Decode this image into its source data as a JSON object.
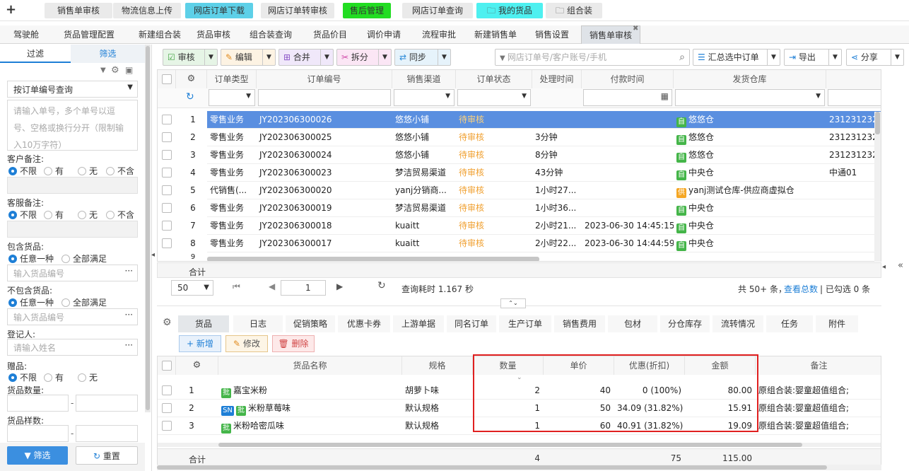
{
  "top_tabs": [
    {
      "label": "销售单审核",
      "bg": "#eaeaea"
    },
    {
      "label": "物流信息上传",
      "bg": "#eaeaea"
    },
    {
      "label": "网店订单下载",
      "bg": "#5dd0e8"
    },
    {
      "label": "网店订单转审核",
      "bg": "#eaeaea"
    },
    {
      "label": "售后管理",
      "bg": "#22dd22"
    },
    {
      "label": "网店订单查询",
      "bg": "#eaeaea"
    },
    {
      "label": "我的货品",
      "bg": "#4ef0f0"
    },
    {
      "label": "组合装",
      "bg": "#eaeaea"
    }
  ],
  "sub_tabs": [
    "驾驶舱",
    "货品管理配置",
    "新建组合装",
    "货品审核",
    "组合装查询",
    "货品价目",
    "调价申请",
    "流程审批",
    "新建销售单",
    "销售设置",
    "销售单审核"
  ],
  "left": {
    "tab_filter": "过滤",
    "tab_screen": "筛选",
    "query_select": "按订单编号查询",
    "order_placeholder": "请输入单号，多个单号以逗号、空格或换行分开（限制输入10万字符）",
    "customer_note": "客户备注:",
    "service_note": "客服备注:",
    "opts4": [
      "不限",
      "有",
      "无",
      "不含"
    ],
    "contains_goods": "包含货品:",
    "not_contains_goods": "不包含货品:",
    "opts2": [
      "任意一种",
      "全部满足"
    ],
    "goods_code_placeholder": "输入货品编号",
    "registrant": "登记人:",
    "name_placeholder": "请输入姓名",
    "gift": "赠品:",
    "opts3": [
      "不限",
      "有",
      "无"
    ],
    "goods_qty": "货品数量:",
    "goods_kinds": "货品样数:",
    "filter_btn": "筛选",
    "reset_btn": "重置"
  },
  "toolbar": {
    "audit": "审核",
    "edit": "编辑",
    "merge": "合并",
    "split": "拆分",
    "sync": "同步",
    "search_placeholder": "网店订单号/客户账号/手机",
    "summary": "汇总选中订单",
    "export": "导出",
    "share": "分享"
  },
  "grid": {
    "headers": [
      "订单类型",
      "订单编号",
      "销售渠道",
      "订单状态",
      "处理时间",
      "付款时间",
      "发货仓库"
    ],
    "rows": [
      {
        "n": "1",
        "type": "零售业务",
        "no": "JY202306300026",
        "ch": "悠悠小铺",
        "st": "待审核",
        "t": "",
        "pay": "",
        "tag": "自",
        "wh": "悠悠仓",
        "ex": "231231232"
      },
      {
        "n": "2",
        "type": "零售业务",
        "no": "JY202306300025",
        "ch": "悠悠小铺",
        "st": "待审核",
        "t": "3分钟",
        "pay": "",
        "tag": "自",
        "wh": "悠悠仓",
        "ex": "231231232"
      },
      {
        "n": "3",
        "type": "零售业务",
        "no": "JY202306300024",
        "ch": "悠悠小铺",
        "st": "待审核",
        "t": "8分钟",
        "pay": "",
        "tag": "自",
        "wh": "悠悠仓",
        "ex": "231231232"
      },
      {
        "n": "4",
        "type": "零售业务",
        "no": "JY202306300023",
        "ch": "梦洁贸易渠道",
        "st": "待审核",
        "t": "43分钟",
        "pay": "",
        "tag": "自",
        "wh": "中央仓",
        "ex": "中通01"
      },
      {
        "n": "5",
        "type": "代销售(...",
        "no": "JY202306300020",
        "ch": "yanj分销商...",
        "st": "待审核",
        "t": "1小时27...",
        "pay": "",
        "tag": "供",
        "wh": "yanj测试仓库-供应商虚拟仓",
        "ex": ""
      },
      {
        "n": "6",
        "type": "零售业务",
        "no": "JY202306300019",
        "ch": "梦洁贸易渠道",
        "st": "待审核",
        "t": "1小时36...",
        "pay": "",
        "tag": "自",
        "wh": "中央仓",
        "ex": ""
      },
      {
        "n": "7",
        "type": "零售业务",
        "no": "JY202306300018",
        "ch": "kuaitt",
        "st": "待审核",
        "t": "2小时21...",
        "pay": "2023-06-30 14:45:15",
        "tag": "自",
        "wh": "中央仓",
        "ex": ""
      },
      {
        "n": "8",
        "type": "零售业务",
        "no": "JY202306300017",
        "ch": "kuaitt",
        "st": "待审核",
        "t": "2小时22...",
        "pay": "2023-06-30 14:44:59",
        "tag": "自",
        "wh": "中央仓",
        "ex": ""
      }
    ],
    "partial_row_no": "9",
    "total_label": "合计"
  },
  "pager": {
    "page_size": "50",
    "page": "1",
    "query_time": "查询耗时 1.167 秒",
    "total": "共 50+ 条，",
    "view_total": "查看总数",
    "selected": "| 已勾选 0 条"
  },
  "bottom_tabs": [
    "货品",
    "日志",
    "促销策略",
    "优惠卡券",
    "上游单据",
    "同名订单",
    "生产订单",
    "销售费用",
    "包材",
    "分仓库存",
    "流转情况",
    "任务",
    "附件"
  ],
  "bottom_actions": {
    "add": "新增",
    "modify": "修改",
    "delete": "删除"
  },
  "sub_grid": {
    "headers": [
      "货品名称",
      "规格",
      "数量",
      "单价",
      "优惠(折扣)",
      "金额",
      "备注"
    ],
    "rows": [
      {
        "n": "1",
        "tags": [
          "批"
        ],
        "name": "嘉宝米粉",
        "spec": "胡萝卜味",
        "qty": "2",
        "price": "40",
        "disc": "0 (100%)",
        "amt": "80.00",
        "note": "原组合装:婴童超值组合;"
      },
      {
        "n": "2",
        "tags": [
          "SN",
          "批"
        ],
        "name": "米粉草莓味",
        "spec": "默认规格",
        "qty": "1",
        "price": "50",
        "disc": "34.09 (31.82%)",
        "amt": "15.91",
        "note": "原组合装:婴童超值组合;"
      },
      {
        "n": "3",
        "tags": [
          "批"
        ],
        "name": "米粉哈密瓜味",
        "spec": "默认规格",
        "qty": "1",
        "price": "60",
        "disc": "40.91 (31.82%)",
        "amt": "19.09",
        "note": "原组合装:婴童超值组合;"
      }
    ],
    "total_label": "合计",
    "total_qty": "4",
    "total_price": "75",
    "total_amt": "115.00"
  }
}
